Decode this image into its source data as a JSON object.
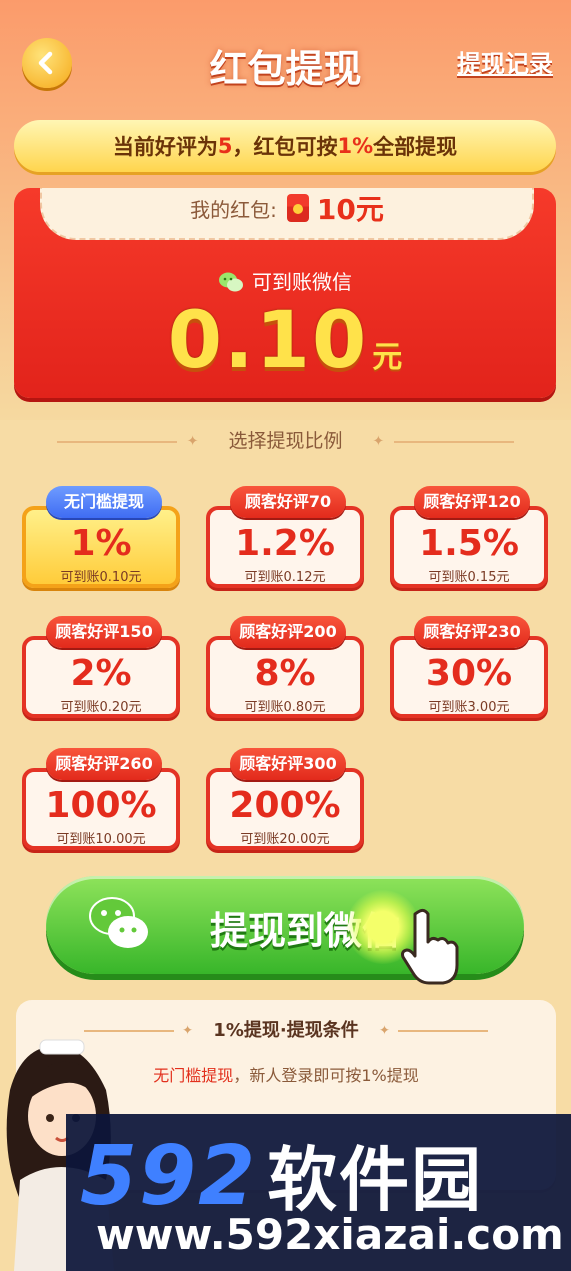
{
  "header": {
    "title": "红包提现",
    "record_link": "提现记录"
  },
  "notice": {
    "prefix": "当前好评为",
    "score": "5",
    "mid": "，红包可按",
    "percent": "1%",
    "suffix": "全部提现"
  },
  "wallet": {
    "label": "我的红包:",
    "amount": "10元",
    "arrive_label": "可到账微信",
    "big_amount": "0.10",
    "big_unit": "元"
  },
  "section_title": "选择提现比例",
  "options": [
    {
      "badge": "无门槛提现",
      "percent": "1%",
      "sub": "可到账0.10元",
      "selected": true
    },
    {
      "badge": "顾客好评70",
      "percent": "1.2%",
      "sub": "可到账0.12元",
      "selected": false
    },
    {
      "badge": "顾客好评120",
      "percent": "1.5%",
      "sub": "可到账0.15元",
      "selected": false
    },
    {
      "badge": "顾客好评150",
      "percent": "2%",
      "sub": "可到账0.20元",
      "selected": false
    },
    {
      "badge": "顾客好评200",
      "percent": "8%",
      "sub": "可到账0.80元",
      "selected": false
    },
    {
      "badge": "顾客好评230",
      "percent": "30%",
      "sub": "可到账3.00元",
      "selected": false
    },
    {
      "badge": "顾客好评260",
      "percent": "100%",
      "sub": "可到账10.00元",
      "selected": false
    },
    {
      "badge": "顾客好评300",
      "percent": "200%",
      "sub": "可到账20.00元",
      "selected": false
    }
  ],
  "withdraw_button": "提现到微信",
  "conditions": {
    "title": "1%提现·提现条件",
    "red": "无门槛提现",
    "gray": "，新人登录即可按1%提现"
  },
  "watermark": {
    "brand_num": "592",
    "brand_cn": "软件园",
    "url": "www.592xiazai.com"
  },
  "colors": {
    "accent_red": "#e42c1d",
    "gold": "#ffe24a",
    "wechat_green": "#38b62a",
    "selected_badge_blue": "#3f6cf3"
  }
}
